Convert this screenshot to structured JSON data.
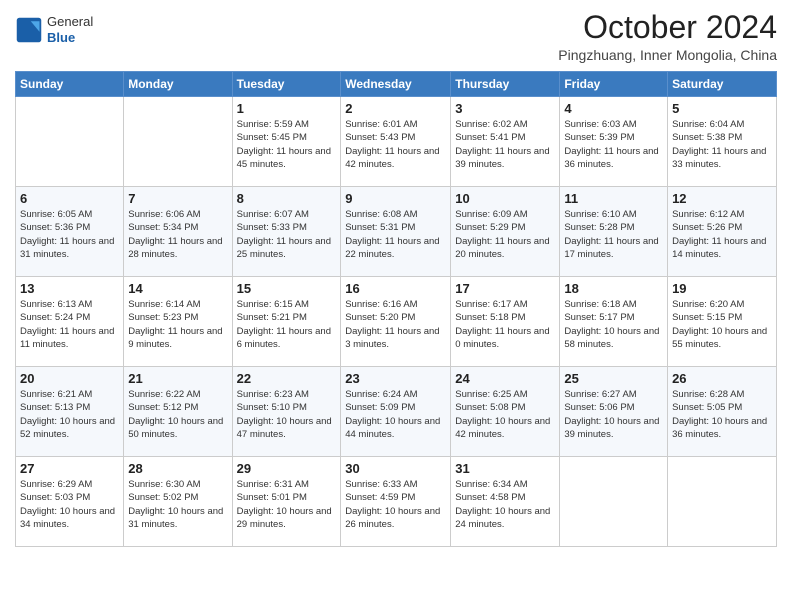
{
  "logo": {
    "line1": "General",
    "line2": "Blue"
  },
  "title": "October 2024",
  "location": "Pingzhuang, Inner Mongolia, China",
  "weekdays": [
    "Sunday",
    "Monday",
    "Tuesday",
    "Wednesday",
    "Thursday",
    "Friday",
    "Saturday"
  ],
  "weeks": [
    [
      {
        "day": "",
        "info": ""
      },
      {
        "day": "",
        "info": ""
      },
      {
        "day": "1",
        "info": "Sunrise: 5:59 AM\nSunset: 5:45 PM\nDaylight: 11 hours and 45 minutes."
      },
      {
        "day": "2",
        "info": "Sunrise: 6:01 AM\nSunset: 5:43 PM\nDaylight: 11 hours and 42 minutes."
      },
      {
        "day": "3",
        "info": "Sunrise: 6:02 AM\nSunset: 5:41 PM\nDaylight: 11 hours and 39 minutes."
      },
      {
        "day": "4",
        "info": "Sunrise: 6:03 AM\nSunset: 5:39 PM\nDaylight: 11 hours and 36 minutes."
      },
      {
        "day": "5",
        "info": "Sunrise: 6:04 AM\nSunset: 5:38 PM\nDaylight: 11 hours and 33 minutes."
      }
    ],
    [
      {
        "day": "6",
        "info": "Sunrise: 6:05 AM\nSunset: 5:36 PM\nDaylight: 11 hours and 31 minutes."
      },
      {
        "day": "7",
        "info": "Sunrise: 6:06 AM\nSunset: 5:34 PM\nDaylight: 11 hours and 28 minutes."
      },
      {
        "day": "8",
        "info": "Sunrise: 6:07 AM\nSunset: 5:33 PM\nDaylight: 11 hours and 25 minutes."
      },
      {
        "day": "9",
        "info": "Sunrise: 6:08 AM\nSunset: 5:31 PM\nDaylight: 11 hours and 22 minutes."
      },
      {
        "day": "10",
        "info": "Sunrise: 6:09 AM\nSunset: 5:29 PM\nDaylight: 11 hours and 20 minutes."
      },
      {
        "day": "11",
        "info": "Sunrise: 6:10 AM\nSunset: 5:28 PM\nDaylight: 11 hours and 17 minutes."
      },
      {
        "day": "12",
        "info": "Sunrise: 6:12 AM\nSunset: 5:26 PM\nDaylight: 11 hours and 14 minutes."
      }
    ],
    [
      {
        "day": "13",
        "info": "Sunrise: 6:13 AM\nSunset: 5:24 PM\nDaylight: 11 hours and 11 minutes."
      },
      {
        "day": "14",
        "info": "Sunrise: 6:14 AM\nSunset: 5:23 PM\nDaylight: 11 hours and 9 minutes."
      },
      {
        "day": "15",
        "info": "Sunrise: 6:15 AM\nSunset: 5:21 PM\nDaylight: 11 hours and 6 minutes."
      },
      {
        "day": "16",
        "info": "Sunrise: 6:16 AM\nSunset: 5:20 PM\nDaylight: 11 hours and 3 minutes."
      },
      {
        "day": "17",
        "info": "Sunrise: 6:17 AM\nSunset: 5:18 PM\nDaylight: 11 hours and 0 minutes."
      },
      {
        "day": "18",
        "info": "Sunrise: 6:18 AM\nSunset: 5:17 PM\nDaylight: 10 hours and 58 minutes."
      },
      {
        "day": "19",
        "info": "Sunrise: 6:20 AM\nSunset: 5:15 PM\nDaylight: 10 hours and 55 minutes."
      }
    ],
    [
      {
        "day": "20",
        "info": "Sunrise: 6:21 AM\nSunset: 5:13 PM\nDaylight: 10 hours and 52 minutes."
      },
      {
        "day": "21",
        "info": "Sunrise: 6:22 AM\nSunset: 5:12 PM\nDaylight: 10 hours and 50 minutes."
      },
      {
        "day": "22",
        "info": "Sunrise: 6:23 AM\nSunset: 5:10 PM\nDaylight: 10 hours and 47 minutes."
      },
      {
        "day": "23",
        "info": "Sunrise: 6:24 AM\nSunset: 5:09 PM\nDaylight: 10 hours and 44 minutes."
      },
      {
        "day": "24",
        "info": "Sunrise: 6:25 AM\nSunset: 5:08 PM\nDaylight: 10 hours and 42 minutes."
      },
      {
        "day": "25",
        "info": "Sunrise: 6:27 AM\nSunset: 5:06 PM\nDaylight: 10 hours and 39 minutes."
      },
      {
        "day": "26",
        "info": "Sunrise: 6:28 AM\nSunset: 5:05 PM\nDaylight: 10 hours and 36 minutes."
      }
    ],
    [
      {
        "day": "27",
        "info": "Sunrise: 6:29 AM\nSunset: 5:03 PM\nDaylight: 10 hours and 34 minutes."
      },
      {
        "day": "28",
        "info": "Sunrise: 6:30 AM\nSunset: 5:02 PM\nDaylight: 10 hours and 31 minutes."
      },
      {
        "day": "29",
        "info": "Sunrise: 6:31 AM\nSunset: 5:01 PM\nDaylight: 10 hours and 29 minutes."
      },
      {
        "day": "30",
        "info": "Sunrise: 6:33 AM\nSunset: 4:59 PM\nDaylight: 10 hours and 26 minutes."
      },
      {
        "day": "31",
        "info": "Sunrise: 6:34 AM\nSunset: 4:58 PM\nDaylight: 10 hours and 24 minutes."
      },
      {
        "day": "",
        "info": ""
      },
      {
        "day": "",
        "info": ""
      }
    ]
  ]
}
